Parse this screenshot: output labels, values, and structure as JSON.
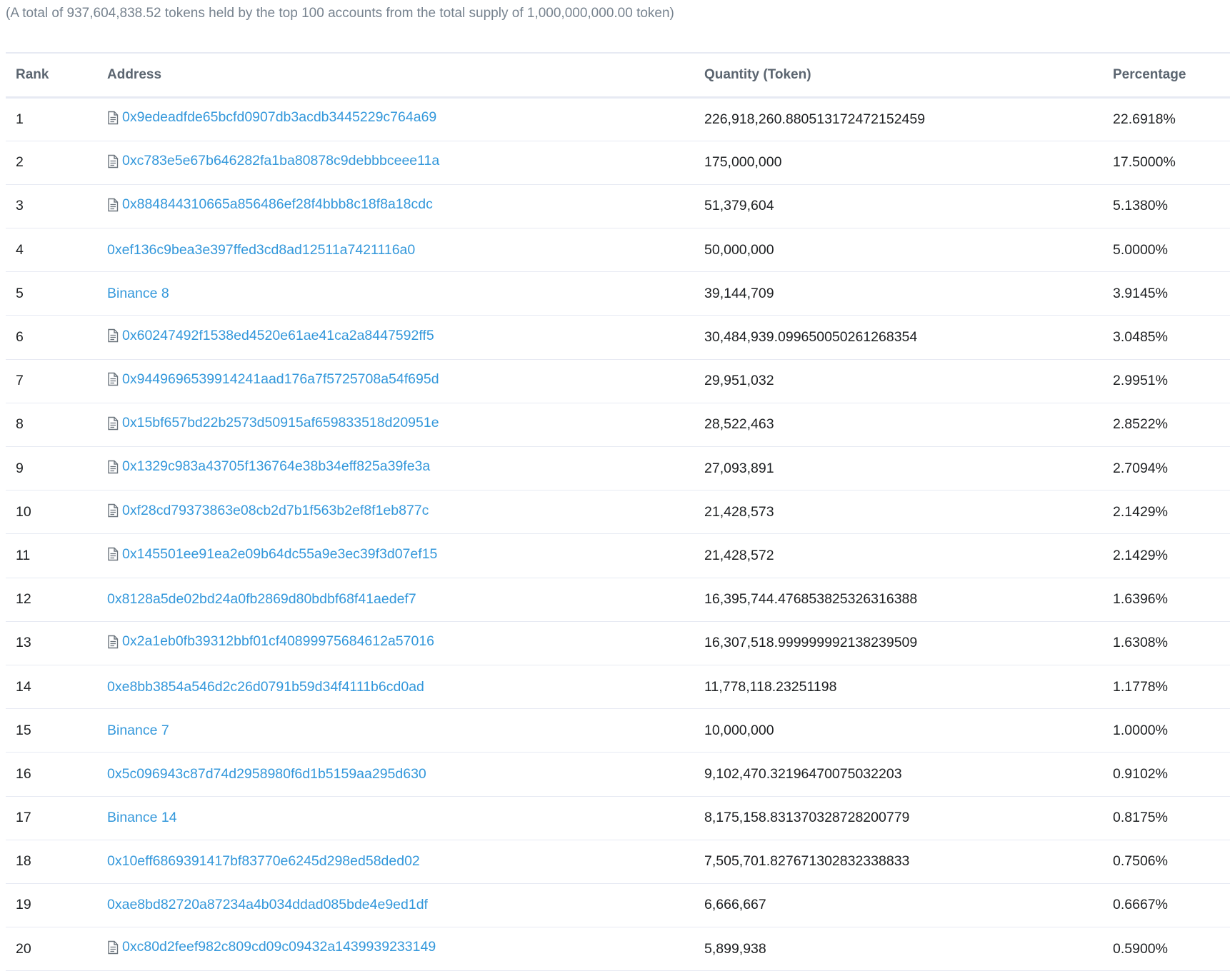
{
  "summary": "(A total of 937,604,838.52 tokens held by the top 100 accounts from the total supply of 1,000,000,000.00 token)",
  "table": {
    "headers": {
      "rank": "Rank",
      "address": "Address",
      "quantity": "Quantity (Token)",
      "percentage": "Percentage"
    },
    "rows": [
      {
        "rank": "1",
        "address": "0x9edeadfde65bcfd0907db3acdb3445229c764a69",
        "contract_icon": true,
        "quantity": "226,918,260.880513172472152459",
        "percentage": "22.6918%"
      },
      {
        "rank": "2",
        "address": "0xc783e5e67b646282fa1ba80878c9debbbceee11a",
        "contract_icon": true,
        "quantity": "175,000,000",
        "percentage": "17.5000%"
      },
      {
        "rank": "3",
        "address": "0x884844310665a856486ef28f4bbb8c18f8a18cdc",
        "contract_icon": true,
        "quantity": "51,379,604",
        "percentage": "5.1380%"
      },
      {
        "rank": "4",
        "address": "0xef136c9bea3e397ffed3cd8ad12511a7421116a0",
        "contract_icon": false,
        "quantity": "50,000,000",
        "percentage": "5.0000%"
      },
      {
        "rank": "5",
        "address": "Binance 8",
        "contract_icon": false,
        "quantity": "39,144,709",
        "percentage": "3.9145%"
      },
      {
        "rank": "6",
        "address": "0x60247492f1538ed4520e61ae41ca2a8447592ff5",
        "contract_icon": true,
        "quantity": "30,484,939.099650050261268354",
        "percentage": "3.0485%"
      },
      {
        "rank": "7",
        "address": "0x9449696539914241aad176a7f5725708a54f695d",
        "contract_icon": true,
        "quantity": "29,951,032",
        "percentage": "2.9951%"
      },
      {
        "rank": "8",
        "address": "0x15bf657bd22b2573d50915af659833518d20951e",
        "contract_icon": true,
        "quantity": "28,522,463",
        "percentage": "2.8522%"
      },
      {
        "rank": "9",
        "address": "0x1329c983a43705f136764e38b34eff825a39fe3a",
        "contract_icon": true,
        "quantity": "27,093,891",
        "percentage": "2.7094%"
      },
      {
        "rank": "10",
        "address": "0xf28cd79373863e08cb2d7b1f563b2ef8f1eb877c",
        "contract_icon": true,
        "quantity": "21,428,573",
        "percentage": "2.1429%"
      },
      {
        "rank": "11",
        "address": "0x145501ee91ea2e09b64dc55a9e3ec39f3d07ef15",
        "contract_icon": true,
        "quantity": "21,428,572",
        "percentage": "2.1429%"
      },
      {
        "rank": "12",
        "address": "0x8128a5de02bd24a0fb2869d80bdbf68f41aedef7",
        "contract_icon": false,
        "quantity": "16,395,744.476853825326316388",
        "percentage": "1.6396%"
      },
      {
        "rank": "13",
        "address": "0x2a1eb0fb39312bbf01cf40899975684612a57016",
        "contract_icon": true,
        "quantity": "16,307,518.999999992138239509",
        "percentage": "1.6308%"
      },
      {
        "rank": "14",
        "address": "0xe8bb3854a546d2c26d0791b59d34f4111b6cd0ad",
        "contract_icon": false,
        "quantity": "11,778,118.23251198",
        "percentage": "1.1778%"
      },
      {
        "rank": "15",
        "address": "Binance 7",
        "contract_icon": false,
        "quantity": "10,000,000",
        "percentage": "1.0000%"
      },
      {
        "rank": "16",
        "address": "0x5c096943c87d74d2958980f6d1b5159aa295d630",
        "contract_icon": false,
        "quantity": "9,102,470.32196470075032203",
        "percentage": "0.9102%"
      },
      {
        "rank": "17",
        "address": "Binance 14",
        "contract_icon": false,
        "quantity": "8,175,158.831370328728200779",
        "percentage": "0.8175%"
      },
      {
        "rank": "18",
        "address": "0x10eff6869391417bf83770e6245d298ed58ded02",
        "contract_icon": false,
        "quantity": "7,505,701.827671302832338833",
        "percentage": "0.7506%"
      },
      {
        "rank": "19",
        "address": "0xae8bd82720a87234a4b034ddad085bde4e9ed1df",
        "contract_icon": false,
        "quantity": "6,666,667",
        "percentage": "0.6667%"
      },
      {
        "rank": "20",
        "address": "0xc80d2feef982c809cd09c09432a1439939233149",
        "contract_icon": true,
        "quantity": "5,899,938",
        "percentage": "0.5900%"
      }
    ]
  }
}
